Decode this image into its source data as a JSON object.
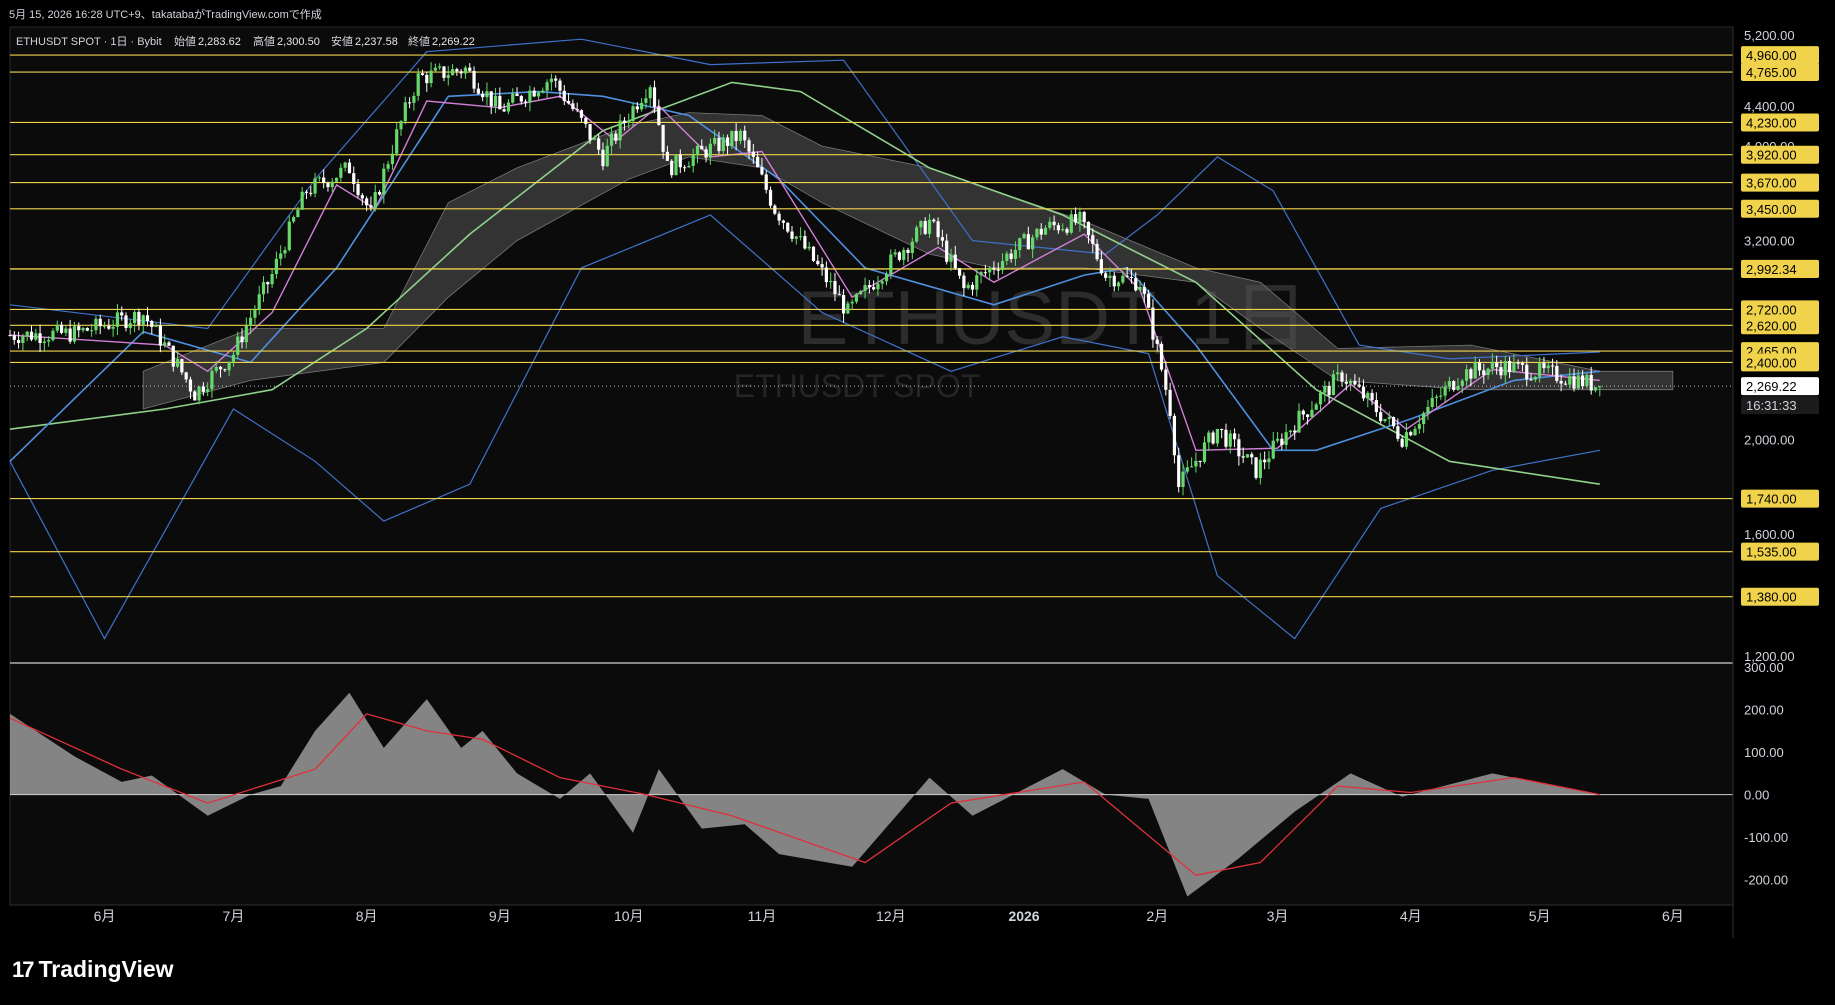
{
  "header": {
    "created_line": "5月 15, 2026 16:28 UTC+9、takatabaがTradingView.comで作成",
    "symbol_line": "ETHUSDT SPOT · 1日 · Bybit",
    "ohlc": [
      {
        "label": "始値",
        "value": "2,283.62"
      },
      {
        "label": "高値",
        "value": "2,300.50"
      },
      {
        "label": "安値",
        "value": "2,237.58"
      },
      {
        "label": "終値",
        "value": "2,269.22"
      }
    ]
  },
  "watermark": {
    "main": "ETHUSDT, 1日",
    "sub": "ETHUSDT SPOT"
  },
  "brand": {
    "logo": "17",
    "name": "TradingView"
  },
  "colors": {
    "background": "#000000",
    "candle_up": "#66d96a",
    "candle_down": "#ffffff",
    "level_line": "#f0d34a",
    "bollinger": "#3f72c9",
    "ma_fast": "#d27fd6",
    "ma_mid": "#4f8fe0",
    "ma_slow": "#8fd18a",
    "ichimoku_cloud": "#555555",
    "macd_hist": "#9a9a9a",
    "macd_signal": "#e0303a",
    "axis_text": "#d1d4dc"
  },
  "chart_data": [
    {
      "type": "candlestick",
      "title": "ETHUSDT SPOT · 1日 · Bybit",
      "y_scale": "log",
      "ylim": [
        1180,
        5300
      ],
      "xlim": [
        "2025-05-10",
        "2026-06-15"
      ],
      "price_ticks": [
        1200,
        1600,
        2000,
        2400,
        3200,
        4000,
        4400,
        4800,
        5200
      ],
      "x_ticks": [
        {
          "date": "2025-06-01",
          "label": "6月"
        },
        {
          "date": "2025-07-01",
          "label": "7月"
        },
        {
          "date": "2025-08-01",
          "label": "8月"
        },
        {
          "date": "2025-09-01",
          "label": "9月"
        },
        {
          "date": "2025-10-01",
          "label": "10月"
        },
        {
          "date": "2025-11-01",
          "label": "11月"
        },
        {
          "date": "2025-12-01",
          "label": "12月"
        },
        {
          "date": "2026-01-01",
          "label": "2026"
        },
        {
          "date": "2026-02-01",
          "label": "2月"
        },
        {
          "date": "2026-03-01",
          "label": "3月"
        },
        {
          "date": "2026-04-01",
          "label": "4月"
        },
        {
          "date": "2026-05-01",
          "label": "5月"
        },
        {
          "date": "2026-06-01",
          "label": "6月"
        }
      ],
      "levels": [
        4960,
        4765,
        4230,
        3920,
        3670,
        3450,
        2993.51,
        2992.34,
        2720,
        2620,
        2465,
        2400,
        1740,
        1535,
        1380
      ],
      "last_price": 2269.22,
      "countdown": "16:31:33",
      "price_path": [
        {
          "date": "2025-05-10",
          "close": 2560
        },
        {
          "date": "2025-05-25",
          "close": 2570
        },
        {
          "date": "2025-06-10",
          "close": 2690
        },
        {
          "date": "2025-06-22",
          "close": 2230
        },
        {
          "date": "2025-07-01",
          "close": 2450
        },
        {
          "date": "2025-07-10",
          "close": 2950
        },
        {
          "date": "2025-07-18",
          "close": 3600
        },
        {
          "date": "2025-07-28",
          "close": 3800
        },
        {
          "date": "2025-08-02",
          "close": 3400
        },
        {
          "date": "2025-08-13",
          "close": 4700
        },
        {
          "date": "2025-08-24",
          "close": 4800
        },
        {
          "date": "2025-09-01",
          "close": 4350
        },
        {
          "date": "2025-09-13",
          "close": 4700
        },
        {
          "date": "2025-09-25",
          "close": 3900
        },
        {
          "date": "2025-10-06",
          "close": 4650
        },
        {
          "date": "2025-10-10",
          "close": 3800
        },
        {
          "date": "2025-10-27",
          "close": 4100
        },
        {
          "date": "2025-11-04",
          "close": 3450
        },
        {
          "date": "2025-11-21",
          "close": 2700
        },
        {
          "date": "2025-12-10",
          "close": 3350
        },
        {
          "date": "2025-12-18",
          "close": 2850
        },
        {
          "date": "2026-01-06",
          "close": 3300
        },
        {
          "date": "2026-01-14",
          "close": 3350
        },
        {
          "date": "2026-01-20",
          "close": 2950
        },
        {
          "date": "2026-01-28",
          "close": 2900
        },
        {
          "date": "2026-02-04",
          "close": 2150
        },
        {
          "date": "2026-02-06",
          "close": 1790
        },
        {
          "date": "2026-02-15",
          "close": 2050
        },
        {
          "date": "2026-02-24",
          "close": 1860
        },
        {
          "date": "2026-03-05",
          "close": 2080
        },
        {
          "date": "2026-03-16",
          "close": 2330
        },
        {
          "date": "2026-03-30",
          "close": 2010
        },
        {
          "date": "2026-04-13",
          "close": 2340
        },
        {
          "date": "2026-04-22",
          "close": 2380
        },
        {
          "date": "2026-05-05",
          "close": 2330
        },
        {
          "date": "2026-05-15",
          "close": 2269.22
        }
      ],
      "bb_upper": [
        {
          "date": "2025-05-10",
          "value": 2750
        },
        {
          "date": "2025-06-25",
          "value": 2600
        },
        {
          "date": "2025-07-20",
          "value": 3700
        },
        {
          "date": "2025-08-15",
          "value": 5000
        },
        {
          "date": "2025-09-20",
          "value": 5150
        },
        {
          "date": "2025-10-20",
          "value": 4850
        },
        {
          "date": "2025-11-20",
          "value": 4900
        },
        {
          "date": "2025-12-20",
          "value": 3200
        },
        {
          "date": "2026-01-20",
          "value": 3100
        },
        {
          "date": "2026-02-01",
          "value": 3400
        },
        {
          "date": "2026-02-15",
          "value": 3900
        },
        {
          "date": "2026-02-28",
          "value": 3600
        },
        {
          "date": "2026-03-20",
          "value": 2500
        },
        {
          "date": "2026-04-10",
          "value": 2420
        },
        {
          "date": "2026-05-15",
          "value": 2460
        }
      ],
      "bb_lower": [
        {
          "date": "2025-05-10",
          "value": 1900
        },
        {
          "date": "2025-06-01",
          "value": 1250
        },
        {
          "date": "2025-07-01",
          "value": 2150
        },
        {
          "date": "2025-07-20",
          "value": 1900
        },
        {
          "date": "2025-08-05",
          "value": 1650
        },
        {
          "date": "2025-08-25",
          "value": 1800
        },
        {
          "date": "2025-09-20",
          "value": 3000
        },
        {
          "date": "2025-10-20",
          "value": 3400
        },
        {
          "date": "2025-11-15",
          "value": 2700
        },
        {
          "date": "2025-12-15",
          "value": 2350
        },
        {
          "date": "2026-01-10",
          "value": 2550
        },
        {
          "date": "2026-01-30",
          "value": 2450
        },
        {
          "date": "2026-02-15",
          "value": 1450
        },
        {
          "date": "2026-03-05",
          "value": 1250
        },
        {
          "date": "2026-03-25",
          "value": 1700
        },
        {
          "date": "2026-04-20",
          "value": 1860
        },
        {
          "date": "2026-05-15",
          "value": 1950
        }
      ],
      "ma_fast": [
        {
          "date": "2025-05-10",
          "value": 2560
        },
        {
          "date": "2025-06-15",
          "value": 2500
        },
        {
          "date": "2025-06-25",
          "value": 2350
        },
        {
          "date": "2025-07-10",
          "value": 2700
        },
        {
          "date": "2025-07-25",
          "value": 3650
        },
        {
          "date": "2025-08-03",
          "value": 3450
        },
        {
          "date": "2025-08-15",
          "value": 4450
        },
        {
          "date": "2025-09-01",
          "value": 4380
        },
        {
          "date": "2025-09-15",
          "value": 4500
        },
        {
          "date": "2025-09-28",
          "value": 4050
        },
        {
          "date": "2025-10-08",
          "value": 4400
        },
        {
          "date": "2025-10-20",
          "value": 3900
        },
        {
          "date": "2025-11-01",
          "value": 3950
        },
        {
          "date": "2025-11-22",
          "value": 2800
        },
        {
          "date": "2025-12-12",
          "value": 3150
        },
        {
          "date": "2025-12-25",
          "value": 2900
        },
        {
          "date": "2026-01-15",
          "value": 3250
        },
        {
          "date": "2026-01-28",
          "value": 2850
        },
        {
          "date": "2026-02-10",
          "value": 1950
        },
        {
          "date": "2026-03-01",
          "value": 1960
        },
        {
          "date": "2026-03-18",
          "value": 2280
        },
        {
          "date": "2026-03-31",
          "value": 2050
        },
        {
          "date": "2026-04-20",
          "value": 2360
        },
        {
          "date": "2026-05-15",
          "value": 2300
        }
      ],
      "ma_mid": [
        {
          "date": "2025-05-10",
          "value": 1900
        },
        {
          "date": "2025-06-10",
          "value": 2580
        },
        {
          "date": "2025-07-05",
          "value": 2400
        },
        {
          "date": "2025-07-25",
          "value": 3000
        },
        {
          "date": "2025-08-20",
          "value": 4500
        },
        {
          "date": "2025-09-10",
          "value": 4550
        },
        {
          "date": "2025-09-25",
          "value": 4500
        },
        {
          "date": "2025-10-15",
          "value": 4300
        },
        {
          "date": "2025-11-05",
          "value": 3700
        },
        {
          "date": "2025-11-25",
          "value": 3000
        },
        {
          "date": "2025-12-25",
          "value": 2750
        },
        {
          "date": "2026-01-15",
          "value": 2950
        },
        {
          "date": "2026-01-25",
          "value": 3000
        },
        {
          "date": "2026-02-10",
          "value": 2500
        },
        {
          "date": "2026-02-28",
          "value": 1950
        },
        {
          "date": "2026-03-10",
          "value": 1950
        },
        {
          "date": "2026-04-01",
          "value": 2100
        },
        {
          "date": "2026-04-25",
          "value": 2300
        },
        {
          "date": "2026-05-15",
          "value": 2350
        }
      ],
      "ma_slow": [
        {
          "date": "2025-05-10",
          "value": 2050
        },
        {
          "date": "2025-06-15",
          "value": 2150
        },
        {
          "date": "2025-07-10",
          "value": 2250
        },
        {
          "date": "2025-08-01",
          "value": 2600
        },
        {
          "date": "2025-08-25",
          "value": 3250
        },
        {
          "date": "2025-09-25",
          "value": 4150
        },
        {
          "date": "2025-10-25",
          "value": 4650
        },
        {
          "date": "2025-11-10",
          "value": 4550
        },
        {
          "date": "2025-12-10",
          "value": 3800
        },
        {
          "date": "2026-01-10",
          "value": 3400
        },
        {
          "date": "2026-02-10",
          "value": 2900
        },
        {
          "date": "2026-03-10",
          "value": 2250
        },
        {
          "date": "2026-04-10",
          "value": 1900
        },
        {
          "date": "2026-05-15",
          "value": 1800
        }
      ],
      "cloud_upper": [
        {
          "date": "2025-06-10",
          "value": 2350
        },
        {
          "date": "2025-07-05",
          "value": 2600
        },
        {
          "date": "2025-08-05",
          "value": 2600
        },
        {
          "date": "2025-08-20",
          "value": 3500
        },
        {
          "date": "2025-09-05",
          "value": 3800
        },
        {
          "date": "2025-10-01",
          "value": 4200
        },
        {
          "date": "2025-10-15",
          "value": 4330
        },
        {
          "date": "2025-11-01",
          "value": 4300
        },
        {
          "date": "2025-11-15",
          "value": 4000
        },
        {
          "date": "2025-12-10",
          "value": 3800
        },
        {
          "date": "2025-12-25",
          "value": 3600
        },
        {
          "date": "2026-01-15",
          "value": 3350
        },
        {
          "date": "2026-02-10",
          "value": 3000
        },
        {
          "date": "2026-02-25",
          "value": 2900
        },
        {
          "date": "2026-03-15",
          "value": 2480
        },
        {
          "date": "2026-04-15",
          "value": 2500
        },
        {
          "date": "2026-05-15",
          "value": 2350
        },
        {
          "date": "2026-06-01",
          "value": 2350
        }
      ],
      "cloud_lower": [
        {
          "date": "2025-06-10",
          "value": 2150
        },
        {
          "date": "2025-07-05",
          "value": 2300
        },
        {
          "date": "2025-08-05",
          "value": 2400
        },
        {
          "date": "2025-08-20",
          "value": 2800
        },
        {
          "date": "2025-09-05",
          "value": 3200
        },
        {
          "date": "2025-10-01",
          "value": 3700
        },
        {
          "date": "2025-10-15",
          "value": 3900
        },
        {
          "date": "2025-11-01",
          "value": 3800
        },
        {
          "date": "2025-11-15",
          "value": 3500
        },
        {
          "date": "2025-12-10",
          "value": 3100
        },
        {
          "date": "2025-12-25",
          "value": 3000
        },
        {
          "date": "2026-01-15",
          "value": 3000
        },
        {
          "date": "2026-02-10",
          "value": 2900
        },
        {
          "date": "2026-02-25",
          "value": 2600
        },
        {
          "date": "2026-03-15",
          "value": 2300
        },
        {
          "date": "2026-04-15",
          "value": 2250
        },
        {
          "date": "2026-05-15",
          "value": 2250
        },
        {
          "date": "2026-06-01",
          "value": 2250
        }
      ]
    },
    {
      "type": "area",
      "ylim": [
        -260,
        310
      ],
      "y_ticks": [
        -200,
        -100,
        0,
        100,
        200,
        300
      ],
      "histogram": [
        {
          "date": "2025-05-10",
          "value": 190
        },
        {
          "date": "2025-05-25",
          "value": 90
        },
        {
          "date": "2025-06-05",
          "value": 30
        },
        {
          "date": "2025-06-12",
          "value": 45
        },
        {
          "date": "2025-06-25",
          "value": -50
        },
        {
          "date": "2025-07-05",
          "value": 0
        },
        {
          "date": "2025-07-12",
          "value": 20
        },
        {
          "date": "2025-07-20",
          "value": 150
        },
        {
          "date": "2025-07-28",
          "value": 240
        },
        {
          "date": "2025-08-05",
          "value": 110
        },
        {
          "date": "2025-08-15",
          "value": 225
        },
        {
          "date": "2025-08-23",
          "value": 110
        },
        {
          "date": "2025-08-28",
          "value": 150
        },
        {
          "date": "2025-09-05",
          "value": 50
        },
        {
          "date": "2025-09-15",
          "value": -10
        },
        {
          "date": "2025-09-22",
          "value": 50
        },
        {
          "date": "2025-10-02",
          "value": -90
        },
        {
          "date": "2025-10-08",
          "value": 60
        },
        {
          "date": "2025-10-18",
          "value": -80
        },
        {
          "date": "2025-10-28",
          "value": -70
        },
        {
          "date": "2025-11-05",
          "value": -140
        },
        {
          "date": "2025-11-22",
          "value": -170
        },
        {
          "date": "2025-12-10",
          "value": 40
        },
        {
          "date": "2025-12-20",
          "value": -50
        },
        {
          "date": "2026-01-10",
          "value": 60
        },
        {
          "date": "2026-01-20",
          "value": 0
        },
        {
          "date": "2026-01-30",
          "value": -10
        },
        {
          "date": "2026-02-08",
          "value": -240
        },
        {
          "date": "2026-02-20",
          "value": -150
        },
        {
          "date": "2026-03-05",
          "value": -40
        },
        {
          "date": "2026-03-18",
          "value": 50
        },
        {
          "date": "2026-03-30",
          "value": -5
        },
        {
          "date": "2026-04-20",
          "value": 50
        },
        {
          "date": "2026-05-15",
          "value": 0
        }
      ],
      "signal": [
        {
          "date": "2025-05-10",
          "value": 180
        },
        {
          "date": "2025-06-05",
          "value": 60
        },
        {
          "date": "2025-06-25",
          "value": -20
        },
        {
          "date": "2025-07-20",
          "value": 60
        },
        {
          "date": "2025-08-01",
          "value": 190
        },
        {
          "date": "2025-08-15",
          "value": 150
        },
        {
          "date": "2025-08-28",
          "value": 130
        },
        {
          "date": "2025-09-15",
          "value": 40
        },
        {
          "date": "2025-10-05",
          "value": 0
        },
        {
          "date": "2025-10-25",
          "value": -50
        },
        {
          "date": "2025-11-25",
          "value": -160
        },
        {
          "date": "2025-12-15",
          "value": -20
        },
        {
          "date": "2026-01-15",
          "value": 30
        },
        {
          "date": "2026-02-10",
          "value": -190
        },
        {
          "date": "2026-02-25",
          "value": -160
        },
        {
          "date": "2026-03-15",
          "value": 20
        },
        {
          "date": "2026-04-01",
          "value": 5
        },
        {
          "date": "2026-04-25",
          "value": 40
        },
        {
          "date": "2026-05-15",
          "value": 0
        }
      ]
    }
  ]
}
